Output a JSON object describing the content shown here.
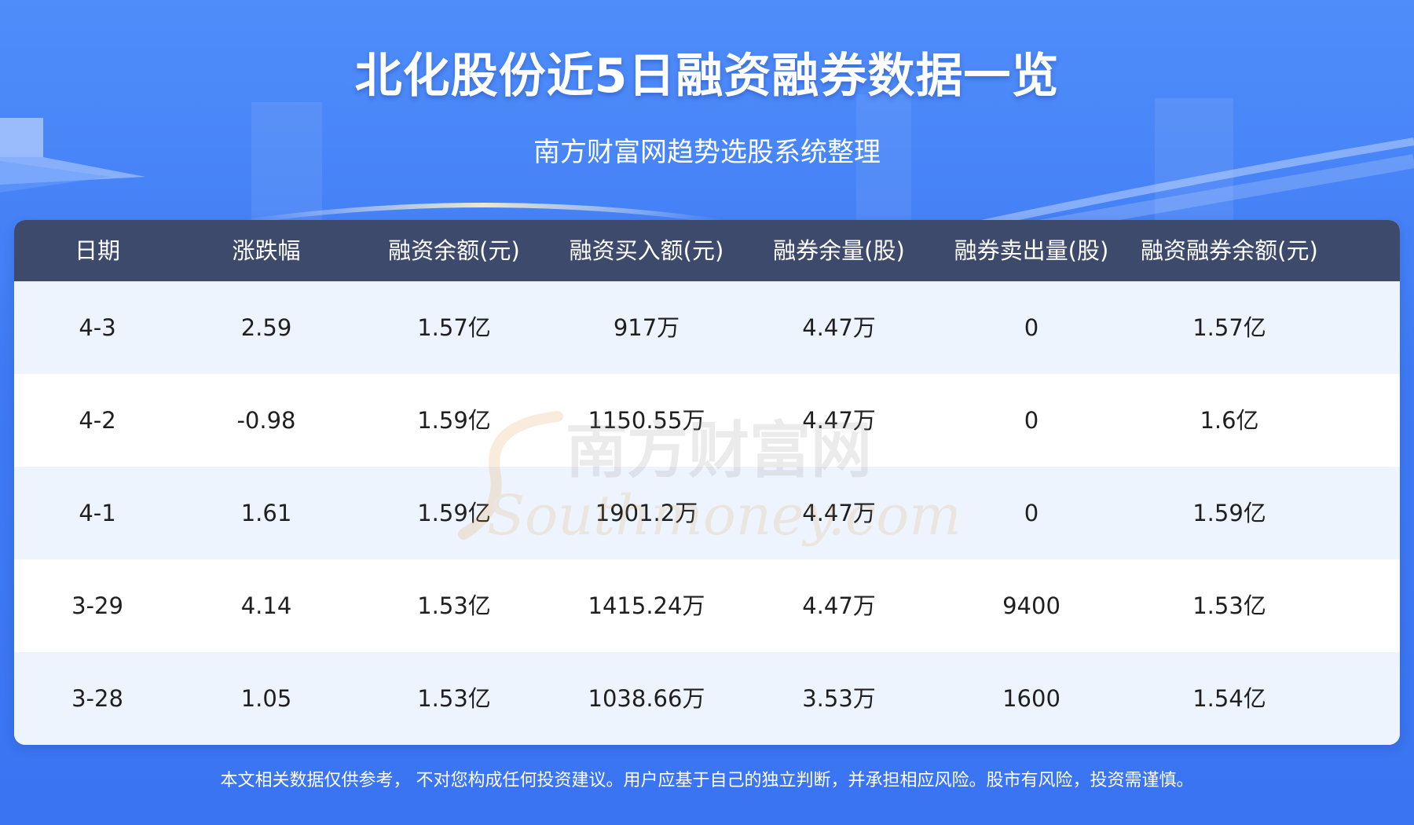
{
  "header": {
    "title": "北化股份近5日融资融券数据一览",
    "subtitle": "南方财富网趋势选股系统整理"
  },
  "table": {
    "columns": [
      "日期",
      "涨跌幅",
      "融资余额(元)",
      "融资买入额(元)",
      "融券余量(股)",
      "融券卖出量(股)",
      "融资融券余额(元)"
    ],
    "rows": [
      [
        "4-3",
        "2.59",
        "1.57亿",
        "917万",
        "4.47万",
        "0",
        "1.57亿"
      ],
      [
        "4-2",
        "-0.98",
        "1.59亿",
        "1150.55万",
        "4.47万",
        "0",
        "1.6亿"
      ],
      [
        "4-1",
        "1.61",
        "1.59亿",
        "1901.2万",
        "4.47万",
        "0",
        "1.59亿"
      ],
      [
        "3-29",
        "4.14",
        "1.53亿",
        "1415.24万",
        "4.47万",
        "9400",
        "1.53亿"
      ],
      [
        "3-28",
        "1.05",
        "1.53亿",
        "1038.66万",
        "3.53万",
        "1600",
        "1.54亿"
      ]
    ]
  },
  "watermark": {
    "cn": "南方财富网",
    "en": "Southmoney.com"
  },
  "footer": {
    "disclaimer": "本文相关数据仅供参考， 不对您构成任何投资建议。用户应基于自己的独立判断，并承担相应风险。股市有风险，投资需谨慎。"
  },
  "colors": {
    "background": "#4283f5",
    "header_row": "#3d4a6b",
    "row_alt": "#eef4fd"
  }
}
